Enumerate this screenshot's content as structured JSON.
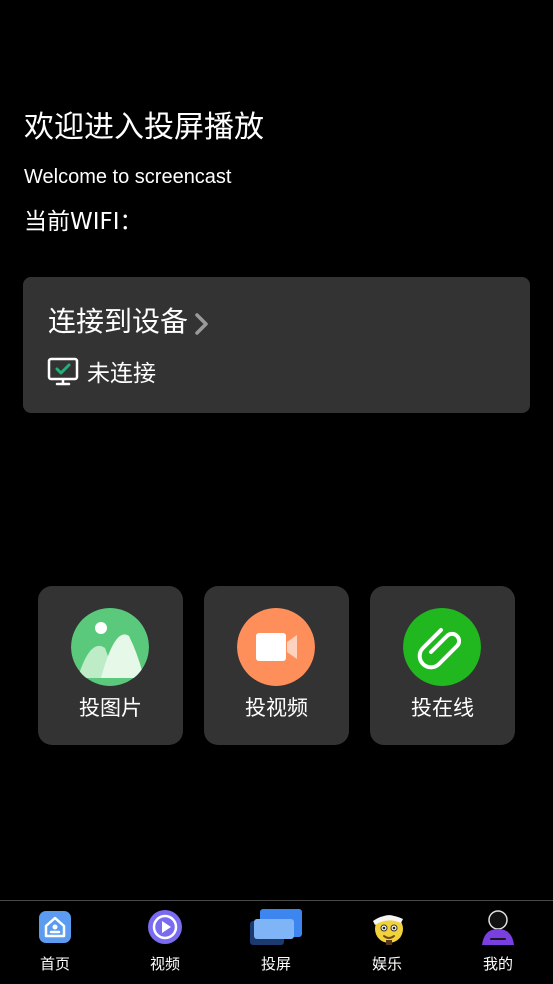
{
  "header": {
    "title": "欢迎进入投屏播放",
    "subtitle": "Welcome to screencast",
    "wifi_label": "当前WIFI："
  },
  "connect": {
    "title": "连接到设备",
    "status": "未连接",
    "icons": {
      "chevron": "chevron-right-icon",
      "status": "tv-monitor-icon"
    }
  },
  "tiles": [
    {
      "label": "投图片",
      "icon": "image-icon",
      "color": "#5ac97b"
    },
    {
      "label": "投视频",
      "icon": "video-camera-icon",
      "color": "#ff8f5a"
    },
    {
      "label": "投在线",
      "icon": "paperclip-icon",
      "color": "#20b81e"
    }
  ],
  "nav": {
    "items": [
      {
        "label": "首页",
        "icon": "home-icon"
      },
      {
        "label": "视频",
        "icon": "play-icon"
      },
      {
        "label": "投屏",
        "icon": "screencast-icon",
        "active": true
      },
      {
        "label": "娱乐",
        "icon": "mascot-icon"
      },
      {
        "label": "我的",
        "icon": "user-icon"
      }
    ]
  },
  "colors": {
    "background": "#000000",
    "card": "#333333",
    "text": "#ffffff",
    "accent_check": "#20b07a"
  }
}
